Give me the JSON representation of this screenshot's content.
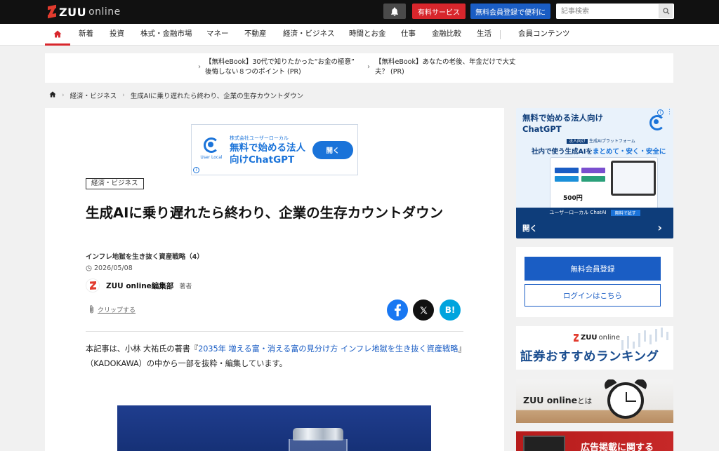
{
  "header": {
    "logo_text": "ZUU",
    "logo_sub": "online",
    "paid_service": "有料サービス",
    "register_free": "無料会員登録で便利に",
    "search_placeholder": "記事検索"
  },
  "nav": {
    "items": [
      {
        "label": "新着"
      },
      {
        "label": "投資"
      },
      {
        "label": "株式・金融市場"
      },
      {
        "label": "マネー"
      },
      {
        "label": "不動産"
      },
      {
        "label": "経済・ビジネス"
      },
      {
        "label": "時間とお金"
      },
      {
        "label": "仕事"
      },
      {
        "label": "金融比較"
      },
      {
        "label": "生活"
      },
      {
        "label": "会員コンテンツ"
      }
    ]
  },
  "pr": {
    "items": [
      {
        "line1": "【無料eBook】30代で知りたかった“お金の極意”",
        "line2": "後悔しない８つのポイント (PR)"
      },
      {
        "line1": "【無料eBook】あなたの老後、年金だけで大丈",
        "line2": "夫？ (PR)"
      }
    ]
  },
  "breadcrumb": {
    "category": "経済・ビジネス",
    "current": "生成AIに乗り遅れたら終わり、企業の生存カウントダウン"
  },
  "ad_banner": {
    "company": "株式会社ユーザーローカル",
    "headline_1": "無料で始める法人",
    "headline_2": "向けChatGPT",
    "logo_text": "User Local",
    "button": "開く"
  },
  "article": {
    "category": "経済・ビジネス",
    "title": "生成AIに乗り遅れたら終わり、企業の生存カウントダウン",
    "series": "インフレ地獄を生き抜く資産戦略（4）",
    "date": "2026/05/08",
    "author": "ZUU online編集部",
    "author_role": "著者",
    "clip": "クリップする",
    "intro_pre": "本記事は、小林 大祐氏の著書『",
    "intro_link": "2035年 増える富・消える富の見分け方 インフレ地獄を生き抜く資産戦略",
    "intro_post": "』（KADOKAWA）の中から一部を抜粋・編集しています。"
  },
  "side_ad": {
    "title_1": "無料で始める法人向け",
    "title_2": "ChatGPT",
    "pill_tag": "法人向け",
    "pill_text": "生成AIプラットフォーム",
    "tagline_pre": "社内で使う生成AIを",
    "tagline_em": "まとめて・安く・安全に",
    "mock_price": "500円",
    "strip": "ユーザーローカル ChatAI",
    "strip_tag": "無料で試す",
    "open": "開く"
  },
  "member": {
    "register": "無料会員登録",
    "login": "ログインはこちら"
  },
  "ranking": {
    "logo": "ZUU",
    "logo_sub": "online",
    "text": "証券おすすめランキング"
  },
  "about": {
    "text": "ZUU online",
    "suffix": "とは"
  },
  "ad_publish": {
    "text": "広告掲載に関する"
  },
  "colors": {
    "brand_red": "#d8262c",
    "brand_blue": "#1a5dc4",
    "ad_blue": "#1a73d9",
    "top_bar": "#111111"
  }
}
